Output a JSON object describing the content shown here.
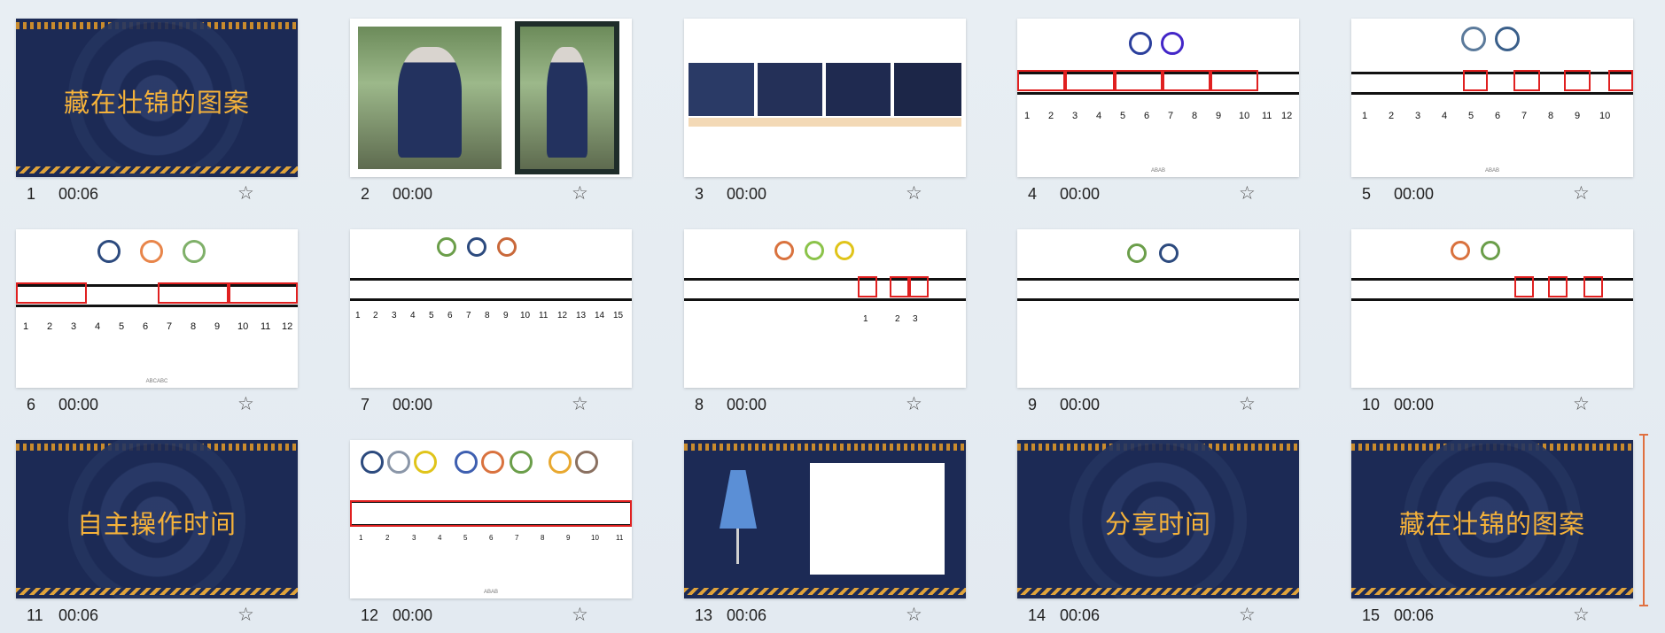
{
  "slides": [
    {
      "number": "1",
      "time": "00:06",
      "title": "藏在壮锦的图案"
    },
    {
      "number": "2",
      "time": "00:00"
    },
    {
      "number": "3",
      "time": "00:00"
    },
    {
      "number": "4",
      "time": "00:00",
      "labels": [
        "1",
        "2",
        "3",
        "4",
        "5",
        "6",
        "7",
        "8",
        "9",
        "10",
        "11",
        "12"
      ],
      "footer": "ABAB"
    },
    {
      "number": "5",
      "time": "00:00",
      "labels": [
        "1",
        "2",
        "3",
        "4",
        "5",
        "6",
        "7",
        "8",
        "9",
        "10"
      ],
      "footer": "ABAB"
    },
    {
      "number": "6",
      "time": "00:00",
      "labels": [
        "1",
        "2",
        "3",
        "4",
        "5",
        "6",
        "7",
        "8",
        "9",
        "10",
        "11",
        "12"
      ],
      "footer": "ABCABC"
    },
    {
      "number": "7",
      "time": "00:00",
      "labels": [
        "1",
        "2",
        "3",
        "4",
        "5",
        "6",
        "7",
        "8",
        "9",
        "10",
        "11",
        "12",
        "13",
        "14",
        "15"
      ]
    },
    {
      "number": "8",
      "time": "00:00",
      "labels": [
        "1",
        "2",
        "3"
      ]
    },
    {
      "number": "9",
      "time": "00:00"
    },
    {
      "number": "10",
      "time": "00:00"
    },
    {
      "number": "11",
      "time": "00:06",
      "title": "自主操作时间"
    },
    {
      "number": "12",
      "time": "00:00",
      "labels": [
        "1",
        "2",
        "3",
        "4",
        "5",
        "6",
        "7",
        "8",
        "9",
        "10",
        "11"
      ],
      "footer": "ABAB"
    },
    {
      "number": "13",
      "time": "00:06"
    },
    {
      "number": "14",
      "time": "00:06",
      "title": "分享时间"
    },
    {
      "number": "15",
      "time": "00:06",
      "title": "藏在壮锦的图案"
    }
  ],
  "icons": {
    "star": "star-outline-icon"
  },
  "colors": {
    "dark_bg": "#1c2a55",
    "title_gold": "#f5b23a",
    "red_box": "#e02020"
  }
}
